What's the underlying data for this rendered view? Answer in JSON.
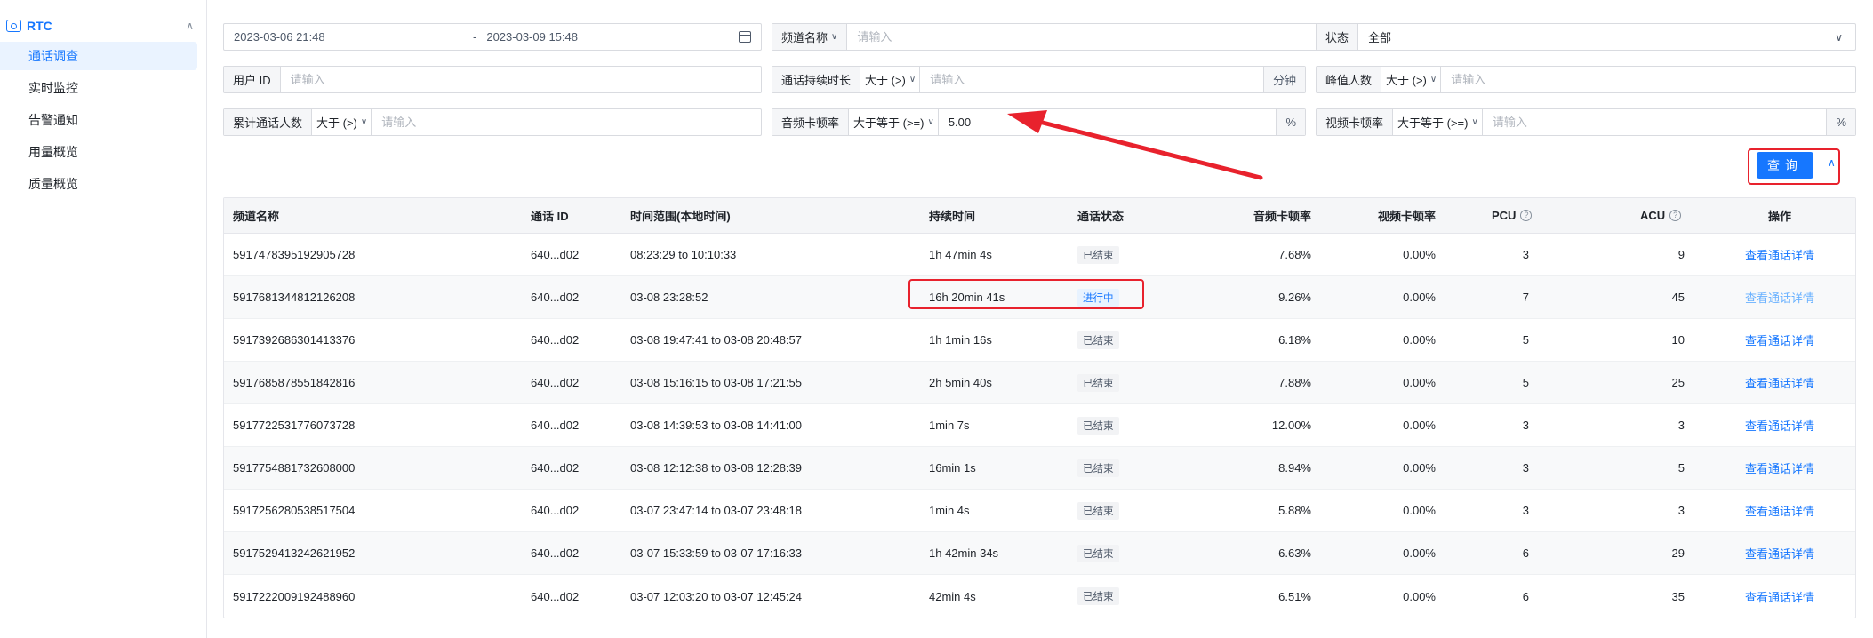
{
  "sidebar": {
    "title": "RTC",
    "items": [
      {
        "label": "通话调查",
        "active": true
      },
      {
        "label": "实时监控",
        "active": false
      },
      {
        "label": "告警通知",
        "active": false
      },
      {
        "label": "用量概览",
        "active": false
      },
      {
        "label": "质量概览",
        "active": false
      }
    ]
  },
  "filters": {
    "date_start": "2023-03-06 21:48",
    "date_sep": "-",
    "date_end": "2023-03-09 15:48",
    "channel_name_label": "频道名称",
    "channel_name_placeholder": "请输入",
    "status_label": "状态",
    "status_value": "全部",
    "user_id_label": "用户 ID",
    "user_id_placeholder": "请输入",
    "duration_label": "通话持续时长",
    "duration_op": "大于 (>)",
    "duration_placeholder": "请输入",
    "duration_unit": "分钟",
    "peak_users_label": "峰值人数",
    "peak_users_op": "大于 (>)",
    "peak_users_placeholder": "请输入",
    "total_users_label": "累计通话人数",
    "total_users_op": "大于 (>)",
    "total_users_placeholder": "请输入",
    "audio_freeze_label": "音频卡顿率",
    "audio_freeze_op": "大于等于 (>=)",
    "audio_freeze_value": "5.00",
    "audio_freeze_unit": "%",
    "video_freeze_label": "视频卡顿率",
    "video_freeze_op": "大于等于 (>=)",
    "video_freeze_placeholder": "请输入",
    "video_freeze_unit": "%",
    "query_label": "查询"
  },
  "table": {
    "headers": [
      "频道名称",
      "通话 ID",
      "时间范围(本地时间)",
      "持续时间",
      "通话状态",
      "音频卡顿率",
      "视频卡顿率",
      "PCU",
      "ACU",
      "操作"
    ],
    "rows": [
      {
        "channel": "5917478395192905728",
        "call_id": "640...d02",
        "time": "08:23:29 to 10:10:33",
        "duration": "1h 47min 4s",
        "status": "已结束",
        "audio": "7.68%",
        "video": "0.00%",
        "pcu": "3",
        "acu": "9",
        "action": "查看通话详情"
      },
      {
        "channel": "5917681344812126208",
        "call_id": "640...d02",
        "time": "03-08 23:28:52",
        "duration": "16h 20min 41s",
        "status": "进行中",
        "audio": "9.26%",
        "video": "0.00%",
        "pcu": "7",
        "acu": "45",
        "action": "查看通话详情"
      },
      {
        "channel": "5917392686301413376",
        "call_id": "640...d02",
        "time": "03-08 19:47:41 to 03-08 20:48:57",
        "duration": "1h 1min 16s",
        "status": "已结束",
        "audio": "6.18%",
        "video": "0.00%",
        "pcu": "5",
        "acu": "10",
        "action": "查看通话详情"
      },
      {
        "channel": "5917685878551842816",
        "call_id": "640...d02",
        "time": "03-08 15:16:15 to 03-08 17:21:55",
        "duration": "2h 5min 40s",
        "status": "已结束",
        "audio": "7.88%",
        "video": "0.00%",
        "pcu": "5",
        "acu": "25",
        "action": "查看通话详情"
      },
      {
        "channel": "5917722531776073728",
        "call_id": "640...d02",
        "time": "03-08 14:39:53 to 03-08 14:41:00",
        "duration": "1min 7s",
        "status": "已结束",
        "audio": "12.00%",
        "video": "0.00%",
        "pcu": "3",
        "acu": "3",
        "action": "查看通话详情"
      },
      {
        "channel": "5917754881732608000",
        "call_id": "640...d02",
        "time": "03-08 12:12:38 to 03-08 12:28:39",
        "duration": "16min 1s",
        "status": "已结束",
        "audio": "8.94%",
        "video": "0.00%",
        "pcu": "3",
        "acu": "5",
        "action": "查看通话详情"
      },
      {
        "channel": "5917256280538517504",
        "call_id": "640...d02",
        "time": "03-07 23:47:14 to 03-07 23:48:18",
        "duration": "1min 4s",
        "status": "已结束",
        "audio": "5.88%",
        "video": "0.00%",
        "pcu": "3",
        "acu": "3",
        "action": "查看通话详情"
      },
      {
        "channel": "5917529413242621952",
        "call_id": "640...d02",
        "time": "03-07 15:33:59 to 03-07 17:16:33",
        "duration": "1h 42min 34s",
        "status": "已结束",
        "audio": "6.63%",
        "video": "0.00%",
        "pcu": "6",
        "acu": "29",
        "action": "查看通话详情"
      },
      {
        "channel": "5917222009192488960",
        "call_id": "640...d02",
        "time": "03-07 12:03:20 to 03-07 12:45:24",
        "duration": "42min 4s",
        "status": "已结束",
        "audio": "6.51%",
        "video": "0.00%",
        "pcu": "6",
        "acu": "35",
        "action": "查看通话详情"
      }
    ]
  },
  "colors": {
    "accent": "#1677ff",
    "annotation": "#e8222d"
  }
}
